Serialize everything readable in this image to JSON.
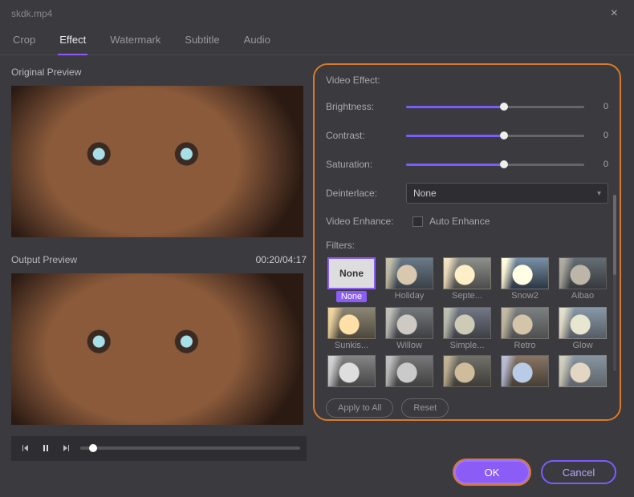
{
  "window": {
    "title": "skdk.mp4"
  },
  "tabs": [
    "Crop",
    "Effect",
    "Watermark",
    "Subtitle",
    "Audio"
  ],
  "tabs_active": "Effect",
  "left": {
    "original_label": "Original Preview",
    "output_label": "Output Preview",
    "timecode": "00:20/04:17"
  },
  "effects": {
    "heading": "Video Effect:",
    "brightness_label": "Brightness:",
    "brightness_value": "0",
    "brightness_pct": 55,
    "contrast_label": "Contrast:",
    "contrast_value": "0",
    "contrast_pct": 55,
    "saturation_label": "Saturation:",
    "saturation_value": "0",
    "saturation_pct": 55,
    "deinterlace_label": "Deinterlace:",
    "deinterlace_value": "None",
    "enhance_label": "Video Enhance:",
    "enhance_check_label": "Auto Enhance",
    "filters_label": "Filters:",
    "filters": [
      "None",
      "Holiday",
      "Septe...",
      "Snow2",
      "Aibao",
      "Sunkis...",
      "Willow",
      "Simple...",
      "Retro",
      "Glow",
      "",
      "",
      "",
      "",
      ""
    ],
    "filters_selected": "None",
    "apply_all_label": "Apply to All",
    "reset_label": "Reset"
  },
  "footer": {
    "ok": "OK",
    "cancel": "Cancel"
  }
}
